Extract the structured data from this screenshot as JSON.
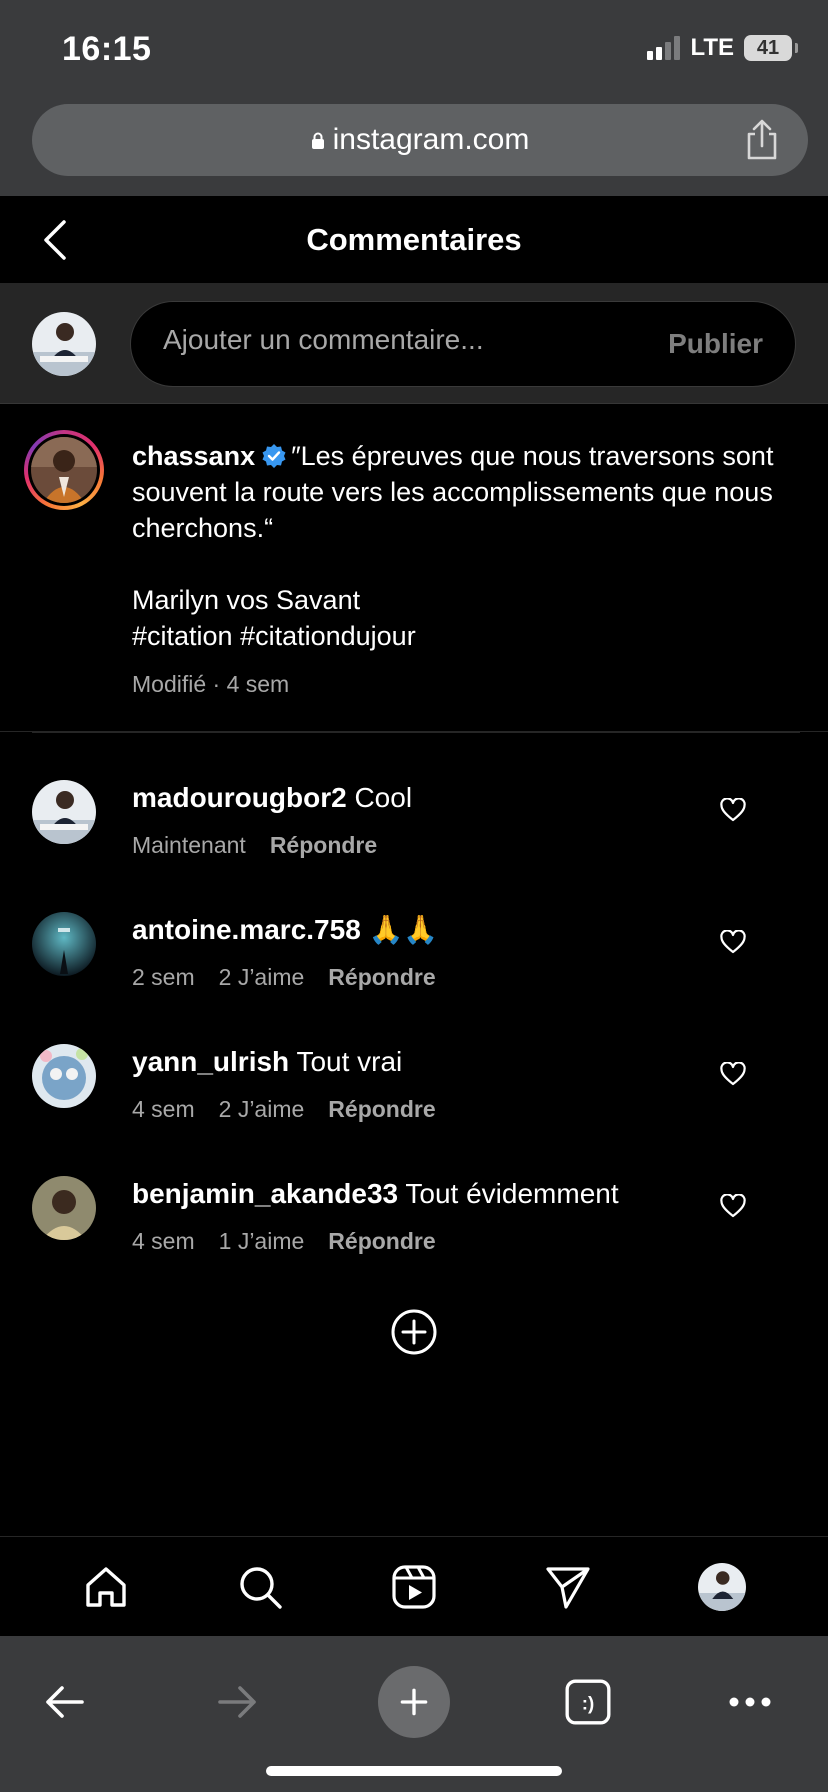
{
  "status_bar": {
    "time": "16:15",
    "network": "LTE",
    "battery": "41"
  },
  "browser": {
    "url": "instagram.com"
  },
  "header": {
    "title": "Commentaires"
  },
  "composer": {
    "placeholder": "Ajouter un commentaire...",
    "publish_label": "Publier"
  },
  "caption": {
    "username": "chassanx",
    "lines": [
      "″Les épreuves que nous traversons sont souvent la route vers les accomplissements que nous cherchons.“",
      "Marilyn vos Savant",
      "#citation #citationdujour"
    ],
    "meta": "Modifié · 4 sem"
  },
  "comments": [
    {
      "username": "madourougbor2",
      "text": "Cool",
      "time": "Maintenant",
      "likes": "",
      "reply": "Répondre"
    },
    {
      "username": "antoine.marc.758",
      "text": "🙏🙏",
      "time": "2 sem",
      "likes": "2 J’aime",
      "reply": "Répondre"
    },
    {
      "username": "yann_ulrish",
      "text": "Tout vrai",
      "time": "4 sem",
      "likes": "2 J’aime",
      "reply": "Répondre"
    },
    {
      "username": "benjamin_akande33",
      "text": "Tout évidemment",
      "time": "4 sem",
      "likes": "1 J’aime",
      "reply": "Répondre"
    }
  ],
  "ig_nav": {
    "icons": [
      "home-icon",
      "search-icon",
      "reels-icon",
      "direct-icon",
      "profile-avatar"
    ]
  },
  "safari_toolbar": {
    "icons": [
      "back-arrow-icon",
      "forward-arrow-icon",
      "new-tab-plus-icon",
      "tabs-icon",
      "more-icon"
    ],
    "tabs_glyph": ":)"
  },
  "colors": {
    "background": "#000000",
    "browser_chrome": "#3a3b3d",
    "secondary_text": "#a8a8a8",
    "verified": "#3897f0"
  }
}
